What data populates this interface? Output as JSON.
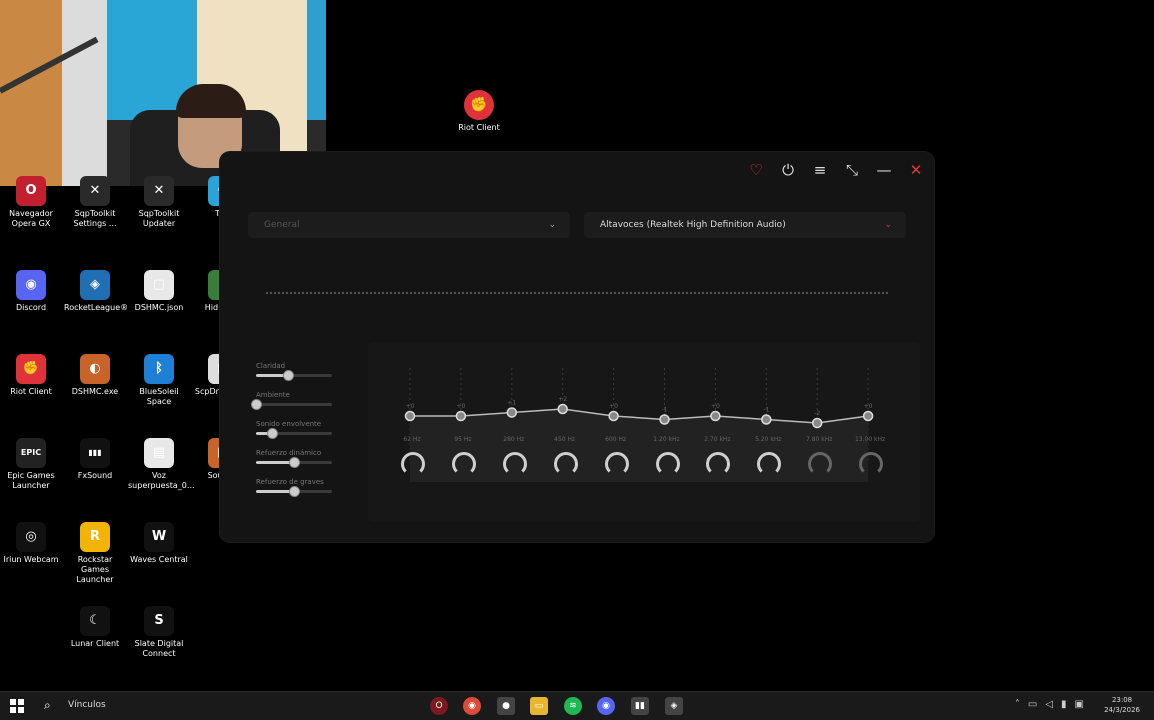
{
  "desktop": {
    "riot_client_label": "Riot Client",
    "icons": [
      {
        "label": "Navegador Opera GX",
        "glyph": "O",
        "color": "#c21f2f",
        "col": 0,
        "row": 0
      },
      {
        "label": "SqpToolkit Settings ...",
        "glyph": "✕",
        "color": "#2a2a2a",
        "col": 1,
        "row": 0
      },
      {
        "label": "SqpToolkit Updater",
        "glyph": "✕",
        "color": "#2a2a2a",
        "col": 2,
        "row": 0
      },
      {
        "label": "Tele",
        "glyph": "✈",
        "color": "#2aa3d8",
        "col": 3,
        "row": 0
      },
      {
        "label": "Discord",
        "glyph": "◉",
        "color": "#5865f2",
        "col": 0,
        "row": 1
      },
      {
        "label": "RocketLeague®",
        "glyph": "◈",
        "color": "#1f6fb2",
        "col": 1,
        "row": 1
      },
      {
        "label": "DSHMC.json",
        "glyph": "▢",
        "color": "#e8e8e8",
        "col": 2,
        "row": 1
      },
      {
        "label": "Hid Confi",
        "glyph": "▮",
        "color": "#3a7d3a",
        "col": 3,
        "row": 1
      },
      {
        "label": "Riot Client",
        "glyph": "✊",
        "color": "#e0323a",
        "col": 0,
        "row": 2
      },
      {
        "label": "DSHMC.exe",
        "glyph": "◐",
        "color": "#c8632a",
        "col": 1,
        "row": 2
      },
      {
        "label": "BlueSoleil Space",
        "glyph": "ᛒ",
        "color": "#1d7fd6",
        "col": 2,
        "row": 2
      },
      {
        "label": "ScpDri Access",
        "glyph": "▤",
        "color": "#dddddd",
        "col": 3,
        "row": 2
      },
      {
        "label": "Epic Games Launcher",
        "glyph": "EPIC",
        "color": "#222222",
        "col": 0,
        "row": 3
      },
      {
        "label": "FxSound",
        "glyph": "▮▮▮",
        "color": "#111111",
        "col": 1,
        "row": 3
      },
      {
        "label": "Voz superpuesta_0...",
        "glyph": "▤",
        "color": "#e8e8e8",
        "col": 2,
        "row": 3
      },
      {
        "label": "Sour Se",
        "glyph": "▣",
        "color": "#c8632a",
        "col": 3,
        "row": 3
      },
      {
        "label": "Iriun Webcam",
        "glyph": "◎",
        "color": "#111111",
        "col": 0,
        "row": 4
      },
      {
        "label": "Rockstar Games Launcher",
        "glyph": "R",
        "color": "#f2b400",
        "col": 1,
        "row": 4
      },
      {
        "label": "Waves Central",
        "glyph": "W",
        "color": "#111111",
        "col": 2,
        "row": 4
      },
      {
        "label": "Lunar Client",
        "glyph": "☾",
        "color": "#111111",
        "col": 1,
        "row": 5
      },
      {
        "label": "Slate Digital Connect",
        "glyph": "S",
        "color": "#111111",
        "col": 2,
        "row": 5
      }
    ]
  },
  "eq_window": {
    "preset_select": "General",
    "device_select": "Altavoces (Realtek High Definition Audio)",
    "sliders": [
      {
        "label": "Claridad",
        "value": 0.42
      },
      {
        "label": "Ambiente",
        "value": 0.0
      },
      {
        "label": "Sonido envolvente",
        "value": 0.21
      },
      {
        "label": "Refuerzo dinámico",
        "value": 0.5
      },
      {
        "label": "Refuerzo de graves",
        "value": 0.5
      }
    ],
    "bands": [
      {
        "freq": "62 Hz",
        "gain": "+0",
        "value": 0,
        "enabled": true
      },
      {
        "freq": "95 Hz",
        "gain": "+0",
        "value": 0,
        "enabled": true
      },
      {
        "freq": "280 Hz",
        "gain": "+1",
        "value": 1,
        "enabled": true
      },
      {
        "freq": "450 Hz",
        "gain": "+2",
        "value": 2,
        "enabled": true
      },
      {
        "freq": "600 Hz",
        "gain": "+0",
        "value": 0,
        "enabled": true
      },
      {
        "freq": "1.20 kHz",
        "gain": "-1",
        "value": -1,
        "enabled": true
      },
      {
        "freq": "2.70 kHz",
        "gain": "+0",
        "value": 0,
        "enabled": true
      },
      {
        "freq": "5.20 kHz",
        "gain": "-1",
        "value": -1,
        "enabled": true
      },
      {
        "freq": "7.80 kHz",
        "gain": "-2",
        "value": -2,
        "enabled": false
      },
      {
        "freq": "13.00 kHz",
        "gain": "+0",
        "value": 0,
        "enabled": false
      }
    ]
  },
  "taskbar": {
    "search_label": "Vínculos",
    "time": "23:08",
    "date": "24/3/2026"
  }
}
